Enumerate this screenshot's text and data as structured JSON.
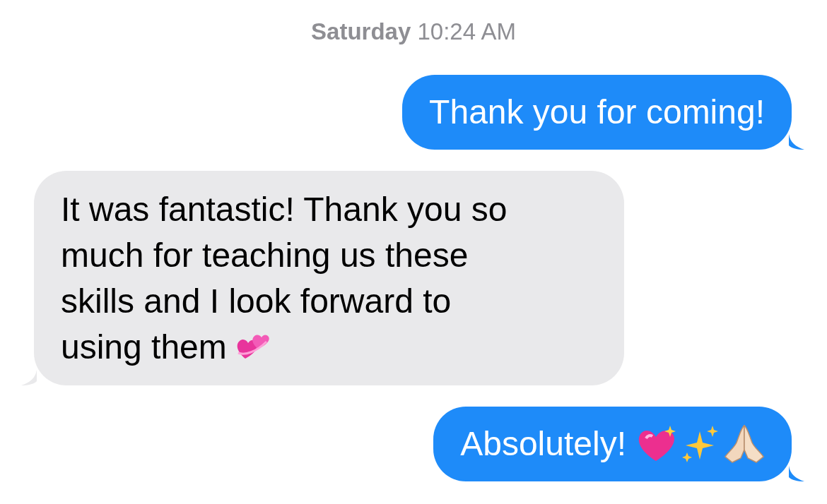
{
  "timestamp": "**Saturday** 10:24 AM",
  "messages": [
    {
      "kind": "sent",
      "lines": [
        "Thank you for coming!"
      ]
    },
    {
      "kind": "received",
      "lines": [
        "It was fantastic! Thank you so",
        "much for teaching us these",
        "skills and I look forward to",
        "using them"
      ],
      "emojis": [
        {
          "kind": "two-hearts"
        }
      ]
    },
    {
      "kind": "sent",
      "lines": [
        "Absolutely!"
      ],
      "emojis": [
        {
          "kind": "sparkling-heart"
        },
        {
          "kind": "sparkles"
        },
        {
          "kind": "praying-hands"
        }
      ]
    }
  ]
}
